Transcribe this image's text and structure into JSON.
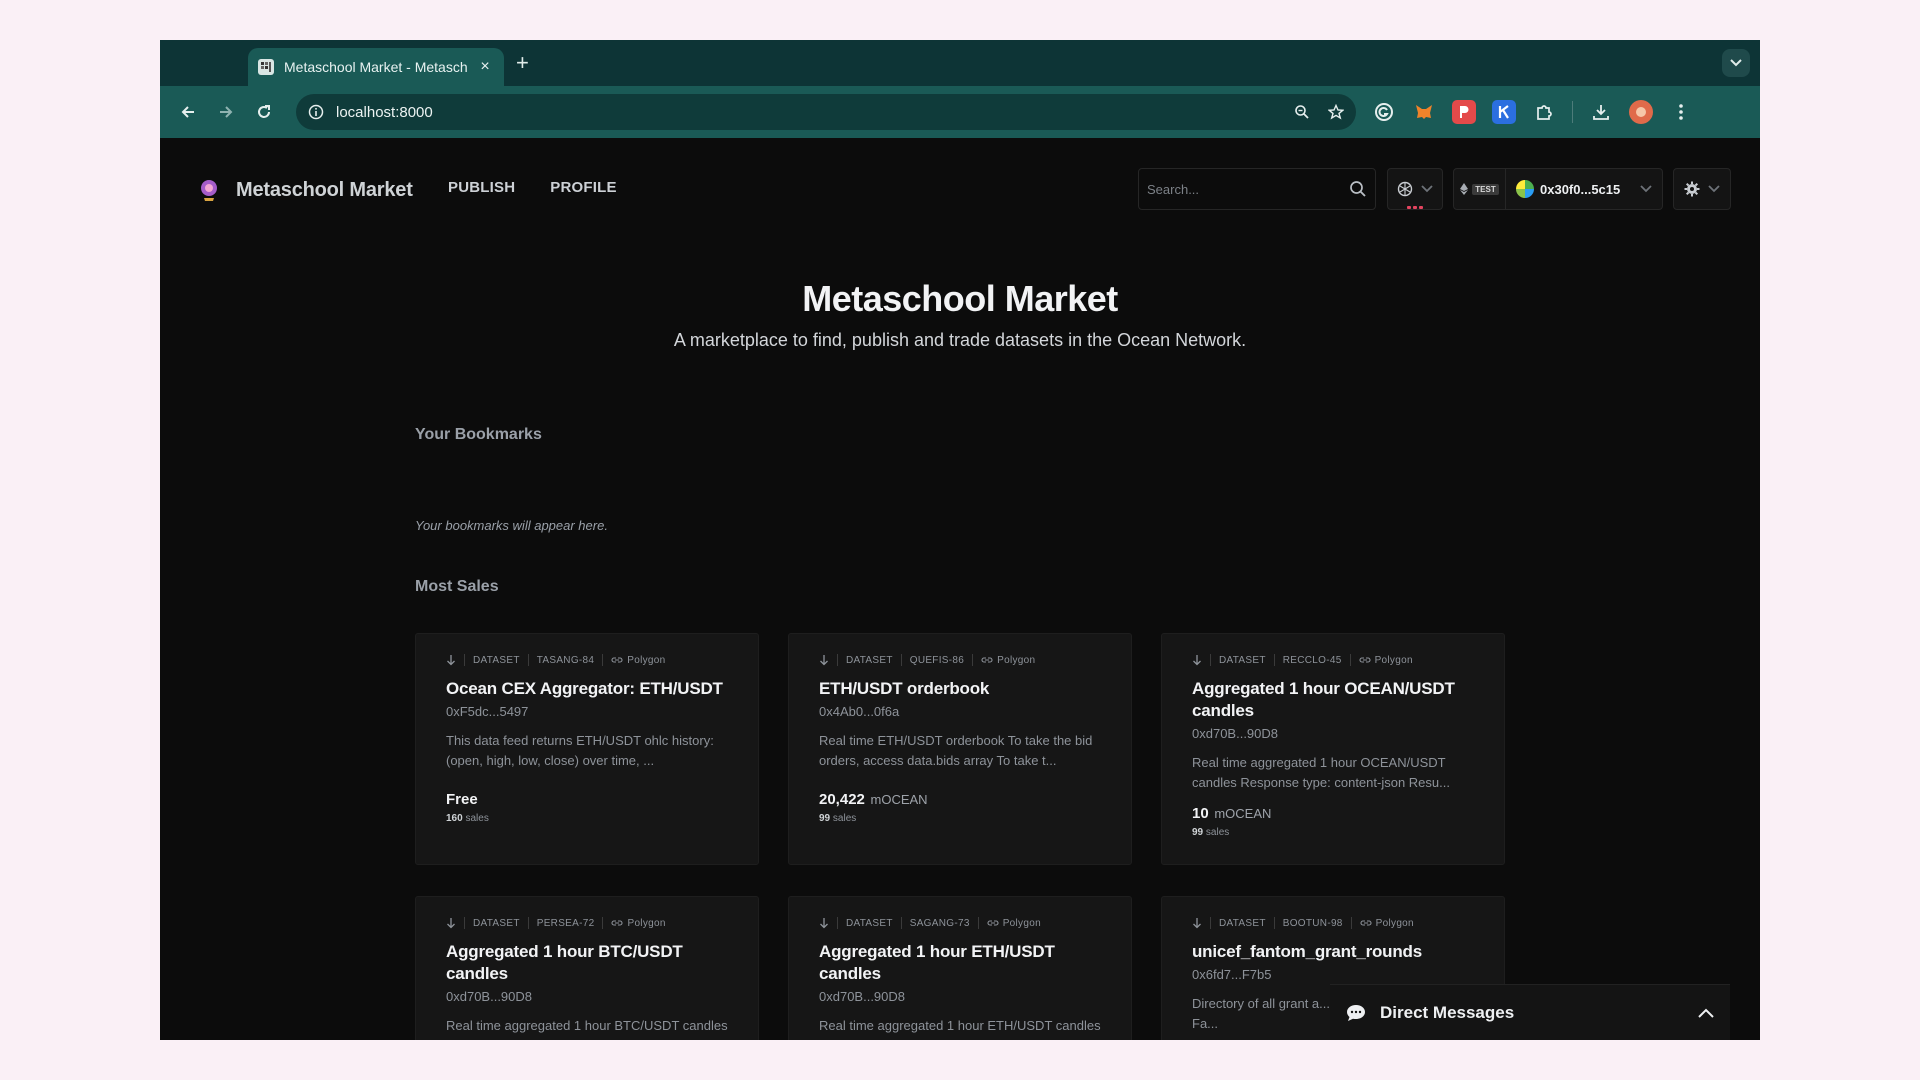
{
  "browser": {
    "tab_title": "Metaschool Market - Metasch",
    "url": "localhost:8000",
    "new_tab_symbol": "+",
    "close_symbol": "×"
  },
  "app": {
    "logo_text": "Metaschool Market",
    "menu": [
      "PUBLISH",
      "PROFILE"
    ],
    "search_placeholder": "Search...",
    "network_badge": "TEST",
    "wallet_address": "0x30f0...5c15"
  },
  "hero": {
    "title": "Metaschool Market",
    "subtitle": "A marketplace to find, publish and trade datasets in the Ocean Network."
  },
  "bookmarks": {
    "title": "Your Bookmarks",
    "empty_text": "Your bookmarks will appear here."
  },
  "most_sales": {
    "title": "Most Sales",
    "cards": [
      {
        "type": "DATASET",
        "symbol": "TASANG-84",
        "network": "Polygon",
        "title": "Ocean CEX Aggregator: ETH/USDT",
        "owner": "0xF5dc...5497",
        "description": "This data feed returns ETH/USDT ohlc history: (open, high, low, close) over time, ...",
        "price_value": "Free",
        "price_unit": "",
        "sales_count": "160",
        "sales_label": "sales"
      },
      {
        "type": "DATASET",
        "symbol": "QUEFIS-86",
        "network": "Polygon",
        "title": "ETH/USDT orderbook",
        "owner": "0x4Ab0...0f6a",
        "description": "Real time ETH/USDT orderbook To take the bid orders, access data.bids array To take t...",
        "price_value": "20,422",
        "price_unit": "mOCEAN",
        "sales_count": "99",
        "sales_label": "sales"
      },
      {
        "type": "DATASET",
        "symbol": "RECCLO-45",
        "network": "Polygon",
        "title": "Aggregated 1 hour OCEAN/USDT candles",
        "owner": "0xd70B...90D8",
        "description": "Real time aggregated 1 hour OCEAN/USDT candles Response type: content-json Resu...",
        "price_value": "10",
        "price_unit": "mOCEAN",
        "sales_count": "99",
        "sales_label": "sales"
      },
      {
        "type": "DATASET",
        "symbol": "PERSEA-72",
        "network": "Polygon",
        "title": "Aggregated 1 hour BTC/USDT candles",
        "owner": "0xd70B...90D8",
        "description": "Real time aggregated 1 hour BTC/USDT candles",
        "price_value": "",
        "price_unit": "",
        "sales_count": "",
        "sales_label": ""
      },
      {
        "type": "DATASET",
        "symbol": "SAGANG-73",
        "network": "Polygon",
        "title": "Aggregated 1 hour ETH/USDT candles",
        "owner": "0xd70B...90D8",
        "description": "Real time aggregated 1 hour ETH/USDT candles",
        "price_value": "",
        "price_unit": "",
        "sales_count": "",
        "sales_label": ""
      },
      {
        "type": "DATASET",
        "symbol": "BOOTUN-98",
        "network": "Polygon",
        "title": "unicef_fantom_grant_rounds",
        "owner": "0x6fd7...F7b5",
        "description": "Directory of all grant a... for the UNICEF and Fa...",
        "price_value": "",
        "price_unit": "",
        "sales_count": "",
        "sales_label": ""
      }
    ]
  },
  "direct_messages": {
    "label": "Direct Messages"
  },
  "colors": {
    "page_bg": "#0c0c0c",
    "card_bg": "#161616",
    "browser_chrome": "#1a5a56",
    "accent_red": "#e4445f"
  },
  "icons": [
    "back-icon",
    "forward-icon",
    "reload-icon",
    "site-info-icon",
    "zoom-icon",
    "star-icon",
    "grammarly-icon",
    "metamask-icon",
    "extension-red-icon",
    "extension-k-icon",
    "extensions-puzzle-icon",
    "download-icon",
    "profile-icon",
    "kebab-menu-icon",
    "search-icon",
    "network-icon",
    "ethereum-icon",
    "gear-icon",
    "chevron-down-icon",
    "download-arrow-icon",
    "link-icon",
    "chat-icon",
    "chevron-up-icon"
  ]
}
